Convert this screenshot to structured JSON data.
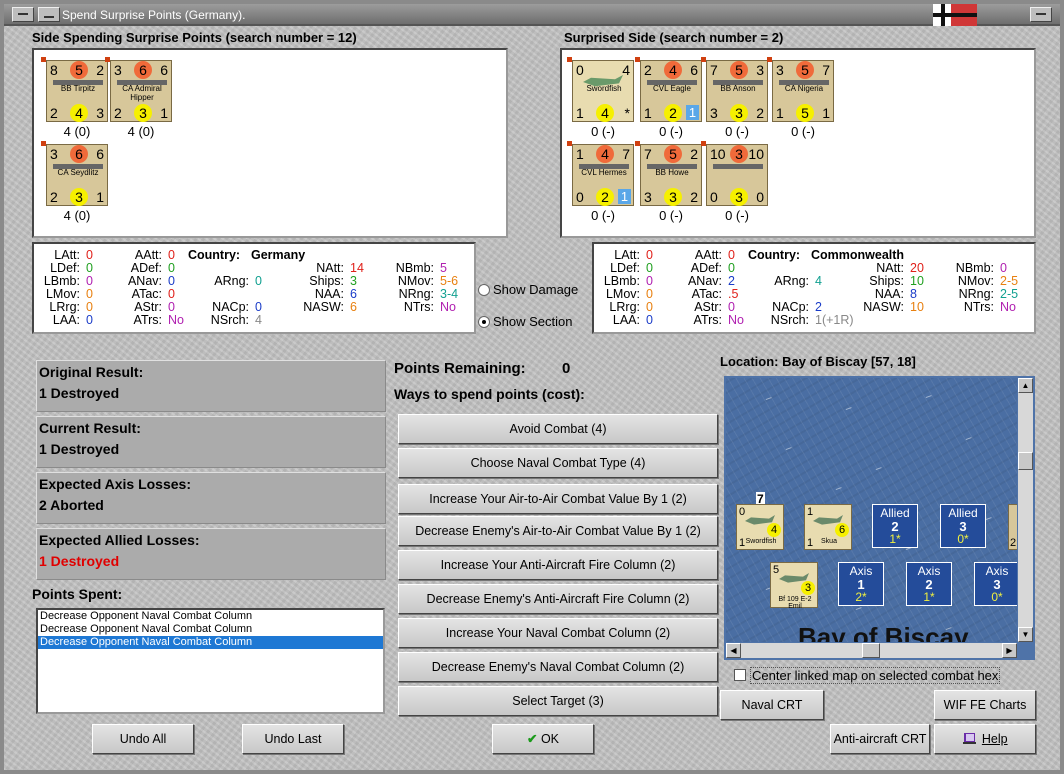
{
  "window": {
    "title": "Spend Surprise Points (Germany)."
  },
  "left_side": {
    "header": "Side Spending Surprise Points (search number = 12)",
    "units": [
      {
        "tl": "8",
        "att": "5",
        "tr": "2",
        "name": "BB Tirpitz",
        "bl": "2",
        "def": "4",
        "br": "3",
        "cap": "4 (0)"
      },
      {
        "tl": "3",
        "att": "6",
        "tr": "6",
        "name": "CA Admiral Hipper",
        "bl": "2",
        "def": "3",
        "br": "1",
        "cap": "4 (0)"
      },
      {
        "tl": "3",
        "att": "6",
        "tr": "6",
        "name": "CA Seydlitz",
        "bl": "2",
        "def": "3",
        "br": "1",
        "cap": "4 (0)"
      }
    ]
  },
  "right_side": {
    "header": "Surprised Side (search number = 2)",
    "units": [
      {
        "tl": "0",
        "att": "",
        "tr": "4",
        "name": "Swordfish",
        "bl": "1",
        "def": "4",
        "br": "*",
        "cap": "0 (-)"
      },
      {
        "tl": "2",
        "att": "4",
        "tr": "6",
        "name": "CVL Eagle",
        "bl": "1",
        "def": "2",
        "br": "1",
        "cap": "0 (-)"
      },
      {
        "tl": "7",
        "att": "5",
        "tr": "3",
        "name": "BB Anson",
        "bl": "3",
        "def": "3",
        "br": "2",
        "cap": "0 (-)"
      },
      {
        "tl": "3",
        "att": "5",
        "tr": "7",
        "name": "CA Nigeria",
        "bl": "1",
        "def": "5",
        "br": "1",
        "cap": "0 (-)"
      },
      {
        "tl": "1",
        "att": "4",
        "tr": "7",
        "name": "CVL Hermes",
        "bl": "0",
        "def": "2",
        "br": "1",
        "cap": "0 (-)"
      },
      {
        "tl": "7",
        "att": "5",
        "tr": "2",
        "name": "BB Howe",
        "bl": "3",
        "def": "3",
        "br": "2",
        "cap": "0 (-)"
      },
      {
        "tl": "10",
        "att": "3",
        "tr": "10",
        "name": "",
        "bl": "0",
        "def": "3",
        "br": "0",
        "cap": "0 (-)"
      }
    ]
  },
  "germany": {
    "country_label": "Country:",
    "country": "Germany",
    "latt": "0",
    "aatt": "0",
    "ldef": "0",
    "adef": "0",
    "lbmb": "0",
    "anav": "0",
    "arng": "0",
    "lmov": "0",
    "atac": "0",
    "lrng": "0",
    "astr": "0",
    "nacp": "0",
    "laa": "0",
    "atrs": "No",
    "nsrch": "4",
    "natt": "14",
    "nbmb": "5",
    "ships": "3",
    "nmov": "5-6",
    "naa": "6",
    "nrng": "3-4",
    "nasw": "6",
    "ntrs": "No"
  },
  "commonwealth": {
    "country_label": "Country:",
    "country": "Commonwealth",
    "latt": "0",
    "aatt": "0",
    "ldef": "0",
    "adef": "0",
    "lbmb": "0",
    "anav": "2",
    "arng": "4",
    "lmov": "0",
    "atac": ".5",
    "lrng": "0",
    "astr": "0",
    "nacp": "2",
    "laa": "0",
    "atrs": "No",
    "nsrch": "1(+1R)",
    "natt": "20",
    "nbmb": "0",
    "ships": "10",
    "nmov": "2-5",
    "naa": "8",
    "nrng": "2-5",
    "nasw": "10",
    "ntrs": "No"
  },
  "stat_labels": {
    "latt": "LAtt:",
    "aatt": "AAtt:",
    "ldef": "LDef:",
    "adef": "ADef:",
    "lbmb": "LBmb:",
    "anav": "ANav:",
    "arng": "ARng:",
    "lmov": "LMov:",
    "atac": "ATac:",
    "lrng": "LRrg:",
    "astr": "AStr:",
    "nacp": "NACp:",
    "laa": "LAA:",
    "atrs": "ATrs:",
    "nsrch": "NSrch:",
    "natt": "NAtt:",
    "nbmb": "NBmb:",
    "ships": "Ships:",
    "nmov": "NMov:",
    "naa": "NAA:",
    "nrng": "NRng:",
    "nasw": "NASW:",
    "ntrs": "NTrs:"
  },
  "options": {
    "show_damage": "Show Damage",
    "show_section": "Show Section",
    "selected": "show_section"
  },
  "results": [
    {
      "title": "Original Result:",
      "value": "1 Destroyed",
      "color": "#000000"
    },
    {
      "title": "Current Result:",
      "value": "1 Destroyed",
      "color": "#000000"
    },
    {
      "title": "Expected Axis Losses:",
      "value": "2 Aborted",
      "color": "#000000"
    },
    {
      "title": "Expected Allied Losses:",
      "value": "1 Destroyed",
      "color": "#e00000"
    }
  ],
  "points_spent": {
    "label": "Points Spent:",
    "items": [
      "Decrease Opponent Naval Combat Column",
      "Decrease Opponent Naval Combat Column",
      "Decrease Opponent Naval Combat Column"
    ],
    "selected_index": 2
  },
  "points_remaining": {
    "label": "Points Remaining:",
    "value": "0"
  },
  "ways_label": "Ways to spend points (cost):",
  "spend_buttons": [
    "Avoid Combat (4)",
    "Choose Naval Combat Type (4)",
    "Increase Your Air-to-Air Combat Value By 1 (2)",
    "Decrease Enemy's Air-to-Air Combat Value By 1 (2)",
    "Increase Your Anti-Aircraft Fire Column (2)",
    "Decrease Enemy's Anti-Aircraft Fire Column (2)",
    "Increase Your Naval Combat Column (2)",
    "Decrease Enemy's Naval Combat Column (2)",
    "Select Target (3)"
  ],
  "location": "Location: Bay of Biscay [57, 18]",
  "map": {
    "sea_name": "Bay of Biscay",
    "stack_count": "7",
    "units": [
      {
        "tl": "0",
        "tr": "",
        "name": "Swordfish",
        "bl": "1",
        "def": "4"
      },
      {
        "tl": "1",
        "tr": "",
        "name": "Skua",
        "bl": "1",
        "def": "6"
      },
      {
        "tl": "5",
        "tr": "",
        "name": "Bf 109 E-2 Emil",
        "bl": "",
        "def": "3"
      }
    ],
    "boxes": [
      {
        "side": "Allied",
        "num": "2",
        "val": "1*"
      },
      {
        "side": "Allied",
        "num": "3",
        "val": "0*"
      },
      {
        "side": "Axis",
        "num": "1",
        "val": "2*"
      },
      {
        "side": "Axis",
        "num": "2",
        "val": "1*"
      },
      {
        "side": "Axis",
        "num": "3",
        "val": "0*"
      }
    ],
    "edge_unit": {
      "tl": "",
      "bl": "2"
    }
  },
  "center_linked": "Center linked map on selected combat hex",
  "buttons": {
    "undo_all": "Undo All",
    "undo_last": "Undo Last",
    "ok": "OK",
    "naval_crt": "Naval CRT",
    "wif_charts": "WIF FE Charts",
    "aa_crt": "Anti-aircraft CRT",
    "help": "Help"
  }
}
